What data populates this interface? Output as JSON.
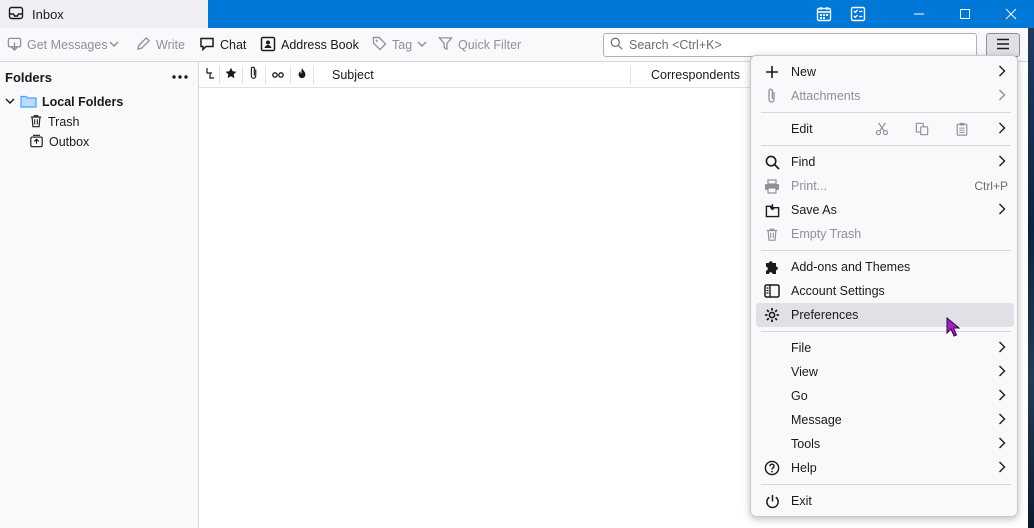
{
  "window": {
    "tab_title": "Inbox"
  },
  "toolbar": {
    "get_messages": "Get Messages",
    "write": "Write",
    "chat": "Chat",
    "address_book": "Address Book",
    "tag": "Tag",
    "quick_filter": "Quick Filter",
    "search_placeholder": "Search <Ctrl+K>"
  },
  "folders": {
    "header": "Folders",
    "items": [
      {
        "label": "Local Folders",
        "icon": "folder-icon",
        "bold": true
      },
      {
        "label": "Trash",
        "icon": "trash-icon"
      },
      {
        "label": "Outbox",
        "icon": "outbox-icon"
      }
    ]
  },
  "thread_columns": {
    "subject": "Subject",
    "correspondents": "Correspondents"
  },
  "app_menu": {
    "new": "New",
    "attachments": "Attachments",
    "edit": "Edit",
    "find": "Find",
    "print": "Print...",
    "print_shortcut": "Ctrl+P",
    "save_as": "Save As",
    "empty_trash": "Empty Trash",
    "addons": "Add-ons and Themes",
    "account_settings": "Account Settings",
    "preferences": "Preferences",
    "file": "File",
    "view": "View",
    "go": "Go",
    "message": "Message",
    "tools": "Tools",
    "help": "Help",
    "exit": "Exit"
  },
  "colors": {
    "titlebar": "#0078d7",
    "cursor": "#a020c0",
    "folder_icon": "#4a9eff"
  }
}
